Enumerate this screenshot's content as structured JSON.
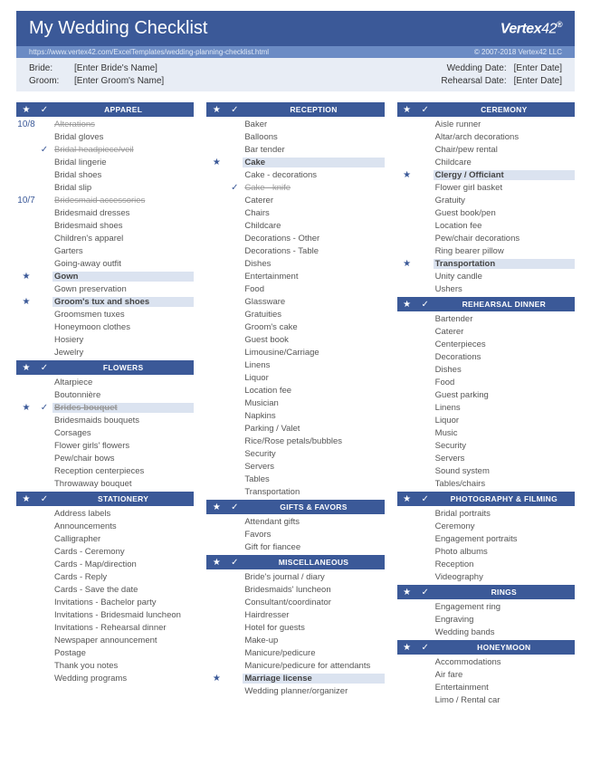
{
  "header": {
    "title": "My Wedding Checklist",
    "logo_main": "Vertex",
    "logo_suffix": "42"
  },
  "subbar": {
    "url": "https://www.vertex42.com/ExcelTemplates/wedding-planning-checklist.html",
    "copyright": "© 2007-2018 Vertex42 LLC"
  },
  "info": {
    "bride_label": "Bride:",
    "bride_value": "[Enter Bride's Name]",
    "groom_label": "Groom:",
    "groom_value": "[Enter Groom's Name]",
    "wedding_label": "Wedding Date:",
    "wedding_value": "[Enter Date]",
    "rehearsal_label": "Rehearsal Date:",
    "rehearsal_value": "[Enter Date]"
  },
  "columns": [
    [
      {
        "title": "APPAREL",
        "items": [
          {
            "text": "Alterations",
            "star": "10/8",
            "done": true
          },
          {
            "text": "Bridal gloves"
          },
          {
            "text": "Bridal headpiece/veil",
            "check": true,
            "done": true
          },
          {
            "text": "Bridal lingerie"
          },
          {
            "text": "Bridal shoes"
          },
          {
            "text": "Bridal slip"
          },
          {
            "text": "Bridesmaid accessories",
            "star": "10/7",
            "done": true
          },
          {
            "text": "Bridesmaid dresses"
          },
          {
            "text": "Bridesmaid shoes"
          },
          {
            "text": "Children's apparel"
          },
          {
            "text": "Garters"
          },
          {
            "text": "Going-away outfit"
          },
          {
            "text": "Gown",
            "star": "★",
            "starred": true
          },
          {
            "text": "Gown preservation"
          },
          {
            "text": "Groom's tux and shoes",
            "star": "★",
            "starred": true
          },
          {
            "text": "Groomsmen tuxes"
          },
          {
            "text": "Honeymoon clothes"
          },
          {
            "text": "Hosiery"
          },
          {
            "text": "Jewelry"
          }
        ]
      },
      {
        "title": "FLOWERS",
        "items": [
          {
            "text": "Altarpiece"
          },
          {
            "text": "Boutonnière"
          },
          {
            "text": "Brides bouquet",
            "star": "★",
            "check": true,
            "done": true,
            "starred": true
          },
          {
            "text": "Bridesmaids bouquets"
          },
          {
            "text": "Corsages"
          },
          {
            "text": "Flower girls' flowers"
          },
          {
            "text": "Pew/chair bows"
          },
          {
            "text": "Reception centerpieces"
          },
          {
            "text": "Throwaway bouquet"
          }
        ]
      },
      {
        "title": "STATIONERY",
        "items": [
          {
            "text": "Address labels"
          },
          {
            "text": "Announcements"
          },
          {
            "text": "Calligrapher"
          },
          {
            "text": "Cards - Ceremony"
          },
          {
            "text": "Cards - Map/direction"
          },
          {
            "text": "Cards - Reply"
          },
          {
            "text": "Cards - Save the date"
          },
          {
            "text": "Invitations - Bachelor party"
          },
          {
            "text": "Invitations - Bridesmaid luncheon"
          },
          {
            "text": "Invitations - Rehearsal dinner"
          },
          {
            "text": "Newspaper announcement"
          },
          {
            "text": "Postage"
          },
          {
            "text": "Thank you notes"
          },
          {
            "text": "Wedding programs"
          }
        ]
      }
    ],
    [
      {
        "title": "RECEPTION",
        "items": [
          {
            "text": "Baker"
          },
          {
            "text": "Balloons"
          },
          {
            "text": "Bar tender"
          },
          {
            "text": "Cake",
            "star": "★",
            "starred": true
          },
          {
            "text": "Cake - decorations"
          },
          {
            "text": "Cake - knife",
            "check": true,
            "done": true
          },
          {
            "text": "Caterer"
          },
          {
            "text": "Chairs"
          },
          {
            "text": "Childcare"
          },
          {
            "text": "Decorations - Other"
          },
          {
            "text": "Decorations - Table"
          },
          {
            "text": "Dishes"
          },
          {
            "text": "Entertainment"
          },
          {
            "text": "Food"
          },
          {
            "text": "Glassware"
          },
          {
            "text": "Gratuities"
          },
          {
            "text": "Groom's cake"
          },
          {
            "text": "Guest book"
          },
          {
            "text": "Limousine/Carriage"
          },
          {
            "text": "Linens"
          },
          {
            "text": "Liquor"
          },
          {
            "text": "Location fee"
          },
          {
            "text": "Musician"
          },
          {
            "text": "Napkins"
          },
          {
            "text": "Parking / Valet"
          },
          {
            "text": "Rice/Rose petals/bubbles"
          },
          {
            "text": "Security"
          },
          {
            "text": "Servers"
          },
          {
            "text": "Tables"
          },
          {
            "text": "Transportation"
          }
        ]
      },
      {
        "title": "GIFTS & FAVORS",
        "items": [
          {
            "text": "Attendant gifts"
          },
          {
            "text": "Favors"
          },
          {
            "text": "Gift for fiancee"
          }
        ]
      },
      {
        "title": "MISCELLANEOUS",
        "items": [
          {
            "text": "Bride's journal / diary"
          },
          {
            "text": "Bridesmaids' luncheon"
          },
          {
            "text": "Consultant/coordinator"
          },
          {
            "text": "Hairdresser"
          },
          {
            "text": "Hotel for guests"
          },
          {
            "text": "Make-up"
          },
          {
            "text": "Manicure/pedicure"
          },
          {
            "text": "Manicure/pedicure for attendants"
          },
          {
            "text": "Marriage license",
            "star": "★",
            "starred": true
          },
          {
            "text": "Wedding planner/organizer"
          }
        ]
      }
    ],
    [
      {
        "title": "CEREMONY",
        "items": [
          {
            "text": "Aisle runner"
          },
          {
            "text": "Altar/arch decorations"
          },
          {
            "text": "Chair/pew rental"
          },
          {
            "text": "Childcare"
          },
          {
            "text": "Clergy / Officiant",
            "star": "★",
            "starred": true
          },
          {
            "text": "Flower girl basket"
          },
          {
            "text": "Gratuity"
          },
          {
            "text": "Guest book/pen"
          },
          {
            "text": "Location fee"
          },
          {
            "text": "Pew/chair decorations"
          },
          {
            "text": "Ring bearer pillow"
          },
          {
            "text": "Transportation",
            "star": "★",
            "starred": true
          },
          {
            "text": "Unity candle"
          },
          {
            "text": "Ushers"
          }
        ]
      },
      {
        "title": "REHEARSAL DINNER",
        "items": [
          {
            "text": "Bartender"
          },
          {
            "text": "Caterer"
          },
          {
            "text": "Centerpieces"
          },
          {
            "text": "Decorations"
          },
          {
            "text": "Dishes"
          },
          {
            "text": "Food"
          },
          {
            "text": "Guest parking"
          },
          {
            "text": "Linens"
          },
          {
            "text": "Liquor"
          },
          {
            "text": "Music"
          },
          {
            "text": "Security"
          },
          {
            "text": "Servers"
          },
          {
            "text": "Sound system"
          },
          {
            "text": "Tables/chairs"
          }
        ]
      },
      {
        "title": "PHOTOGRAPHY & FILMING",
        "items": [
          {
            "text": "Bridal portraits"
          },
          {
            "text": "Ceremony"
          },
          {
            "text": "Engagement portraits"
          },
          {
            "text": "Photo albums"
          },
          {
            "text": "Reception"
          },
          {
            "text": "Videography"
          }
        ]
      },
      {
        "title": "RINGS",
        "items": [
          {
            "text": "Engagement ring"
          },
          {
            "text": "Engraving"
          },
          {
            "text": "Wedding bands"
          }
        ]
      },
      {
        "title": "HONEYMOON",
        "items": [
          {
            "text": "Accommodations"
          },
          {
            "text": "Air fare"
          },
          {
            "text": "Entertainment"
          },
          {
            "text": "Limo / Rental car"
          }
        ]
      }
    ]
  ]
}
